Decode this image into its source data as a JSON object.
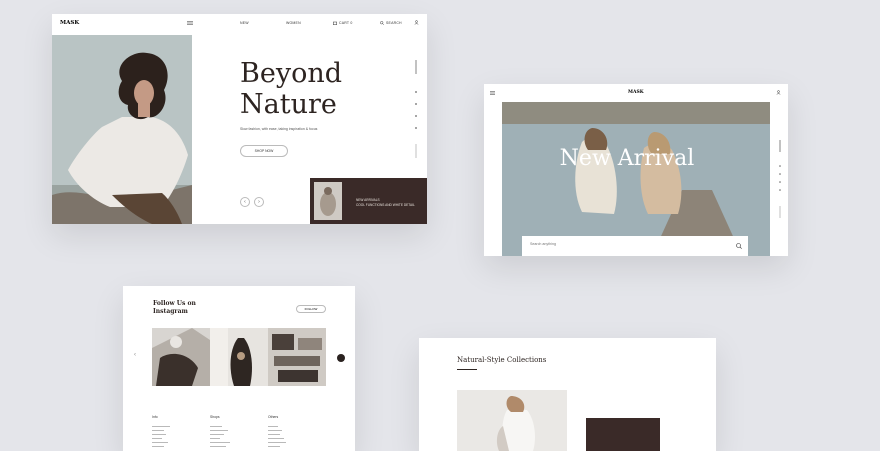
{
  "card1": {
    "nav": {
      "logo": "MASK",
      "item1": "NEW",
      "item2": "WOMEN",
      "item3": "CART 0",
      "item4": "SEARCH"
    },
    "hero": {
      "title_line1": "Beyond",
      "title_line2": "Nature",
      "subtitle": "Slow fashion, with ease, taking inspiration & focus",
      "cta": "SHOP NOW",
      "prev": "‹",
      "next": "›"
    },
    "promo": {
      "line1": "NEW ARRIVALS",
      "line2": "COOL FUNCTIONS AND WHITE DETAIL"
    }
  },
  "card2": {
    "logo": "MASK",
    "title": "New Arrival",
    "search_placeholder": "Search anything"
  },
  "card3": {
    "title_line1": "Follow Us on",
    "title_line2": "Instagram",
    "follow_label": "FOLLOW",
    "prev": "‹",
    "columns": [
      {
        "heading": "Info"
      },
      {
        "heading": "Shops"
      },
      {
        "heading": "Others"
      }
    ]
  },
  "card4": {
    "title": "Natural-Style Collections"
  },
  "colors": {
    "background": "#e4e5ea",
    "dark_brown": "#3a2a28",
    "text_dark": "#2d2421"
  }
}
